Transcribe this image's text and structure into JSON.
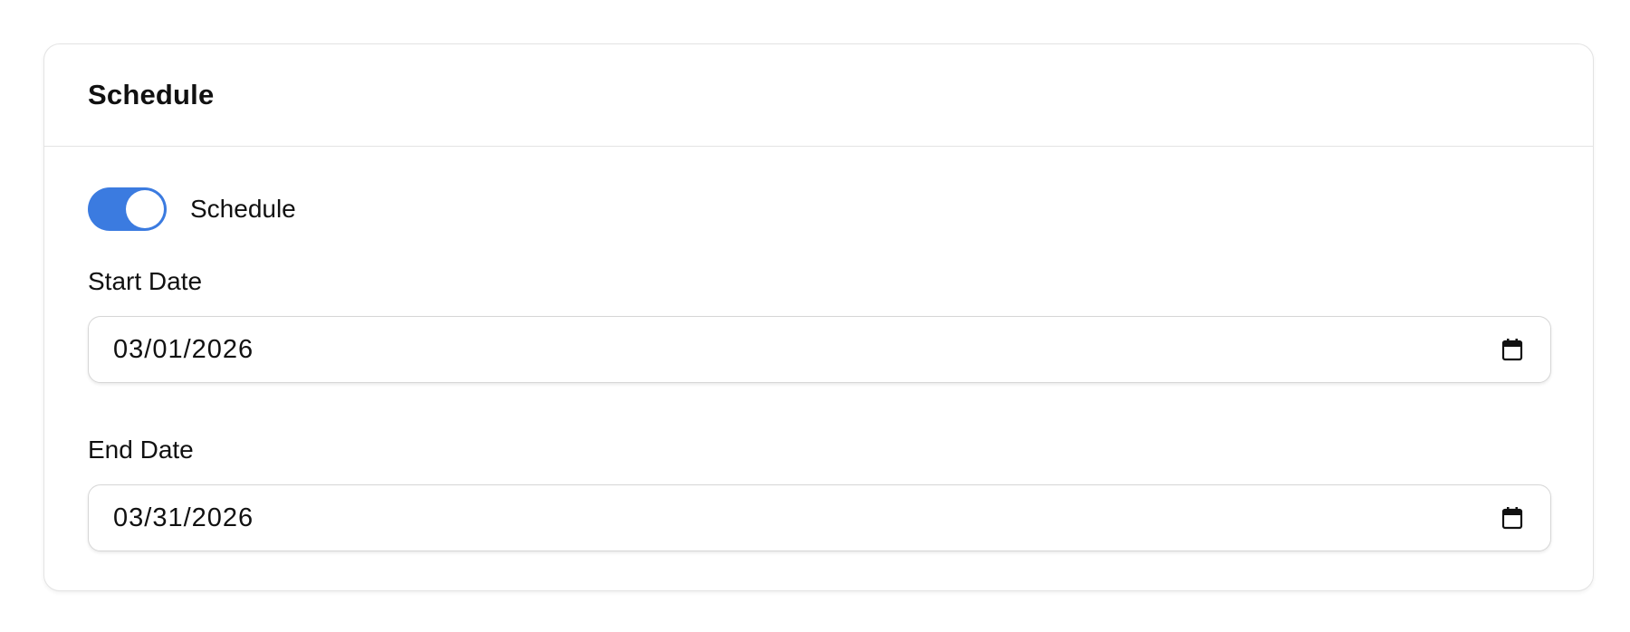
{
  "card": {
    "title": "Schedule"
  },
  "schedule_toggle": {
    "label": "Schedule",
    "enabled": true,
    "accent_color": "#3b7be0"
  },
  "start_date": {
    "label": "Start Date",
    "value": "03/01/2026",
    "icon": "calendar-icon"
  },
  "end_date": {
    "label": "End Date",
    "value": "03/31/2026",
    "icon": "calendar-icon"
  }
}
